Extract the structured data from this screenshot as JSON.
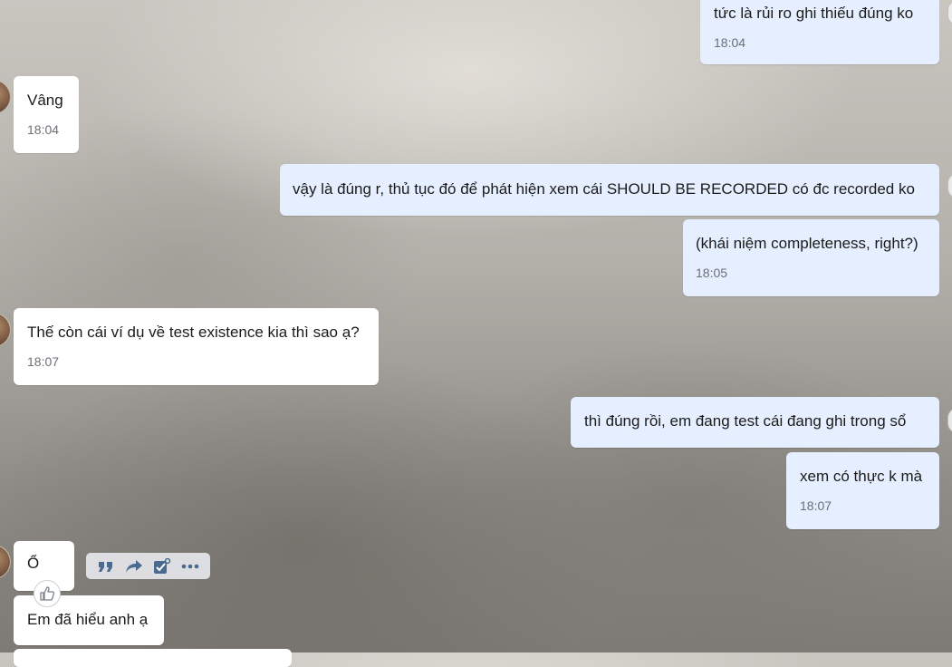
{
  "messages": [
    {
      "dir": "out",
      "text": "tức là rủi ro ghi thiếu đúng ko",
      "time": "18:04"
    },
    {
      "dir": "in",
      "text": "Vâng",
      "time": "18:04"
    },
    {
      "dir": "out",
      "text": "vậy là đúng r, thủ tục đó để phát hiện xem cái SHOULD BE RECORDED có đc recorded ko",
      "time": ""
    },
    {
      "dir": "out",
      "text": "(khái niệm completeness, right?)",
      "time": "18:05"
    },
    {
      "dir": "in",
      "text": "Thế còn cái ví dụ về test existence kia thì sao ạ?",
      "time": "18:07"
    },
    {
      "dir": "out",
      "text": "thì đúng rồi, em đang test cái đang ghi trong sổ",
      "time": ""
    },
    {
      "dir": "out",
      "text": "xem có thực k mà",
      "time": "18:07"
    },
    {
      "dir": "in",
      "text": "Ổ",
      "time": ""
    },
    {
      "dir": "in",
      "text": "Em đã hiểu anh ạ",
      "time": ""
    }
  ],
  "hover_actions": [
    "quote-icon",
    "forward-icon",
    "task-icon",
    "more-icon"
  ],
  "colors": {
    "outgoing_bubble": "#e5efff",
    "incoming_bubble": "#ffffff",
    "time_text": "#6b6f75"
  }
}
